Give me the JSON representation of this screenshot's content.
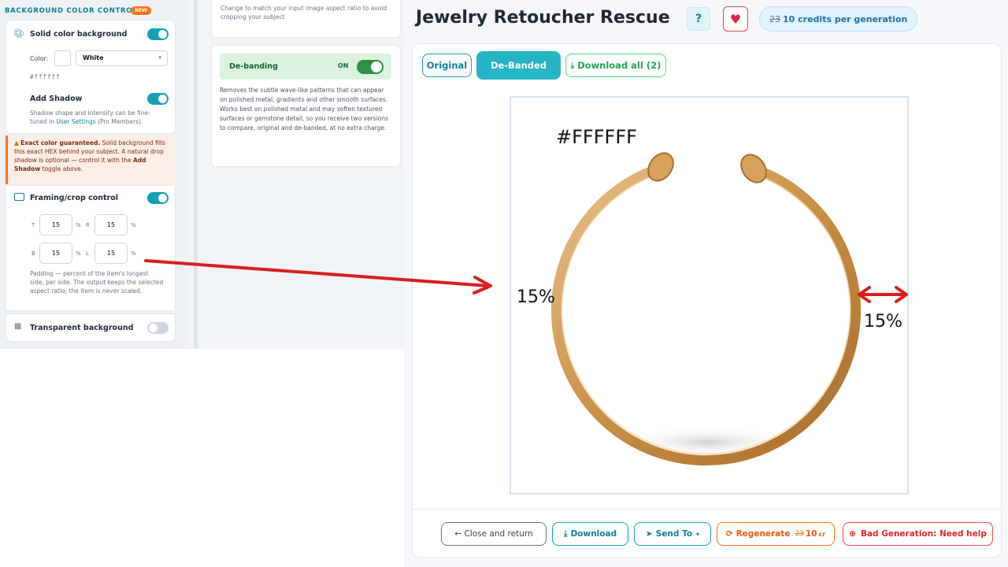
{
  "left_panel": {
    "section_title": "BACKGROUND COLOR CONTROL",
    "new_badge": "NEW",
    "solid_color": {
      "label": "Solid color background",
      "color_label": "Color:",
      "color_select": "White",
      "hex": "#ffffff",
      "add_shadow_label": "Add Shadow",
      "shadow_desc_1": "Shadow shape and intensity can be fine-",
      "shadow_desc_2_pre": "tuned in ",
      "shadow_desc_link": "User Settings",
      "shadow_desc_2_post": " (Pro Members)."
    },
    "warning": {
      "strong": "Exact color guaranteed.",
      "text_1": " Solid background fills this exact HEX behind your subject. A natural drop shadow is optional — control it with the ",
      "strong_2": "Add Shadow",
      "text_2": " toggle above."
    },
    "framing": {
      "label": "Framing/crop control",
      "t_label": "T",
      "t_value": "15",
      "r_label": "R",
      "r_value": "15",
      "b_label": "B",
      "b_value": "15",
      "l_label": "L",
      "l_value": "15",
      "unit": "%",
      "desc": "Padding — percent of the item's longest side, per side. The output keeps the selected aspect ratio; the item is never scaled."
    },
    "transparent": {
      "label": "Transparent background",
      "enabled": false
    }
  },
  "middle": {
    "aspect_note": "Change to match your input image aspect ratio to avoid cropping your subject",
    "debanding": {
      "title": "De-banding",
      "state": "ON",
      "desc": "Removes the subtle wave-like patterns that can appear on polished metal, gradients and other smooth surfaces. Works best on polished metal and may soften textured surfaces or gemstone detail, so you receive two versions to compare, original and de-banded, at no extra charge."
    }
  },
  "main": {
    "title": "Jewelry Retoucher Rescue",
    "help_label": "?",
    "credits_old": "23",
    "credits_text": "10 credits per generation",
    "tabs": {
      "original": "Original",
      "debanded": "De-Banded",
      "download_all": "Download all (2)"
    },
    "annotations": {
      "hex": "#FFFFFF",
      "left_pct": "15%",
      "right_pct": "15%"
    },
    "footer": {
      "close": "← Close and return",
      "download": "Download",
      "send_to": "Send To",
      "regenerate": "Regenerate",
      "regen_old": "23",
      "regen_new": "10",
      "regen_unit": "cr",
      "bad_generation": "Bad Generation: Need help"
    }
  },
  "colors": {
    "accent_teal": "#14a0b4",
    "warning_orange": "#f97316",
    "danger_red": "#dc2626",
    "annotation_red": "#d91e1e",
    "ring_gold": "#d7a35e"
  }
}
